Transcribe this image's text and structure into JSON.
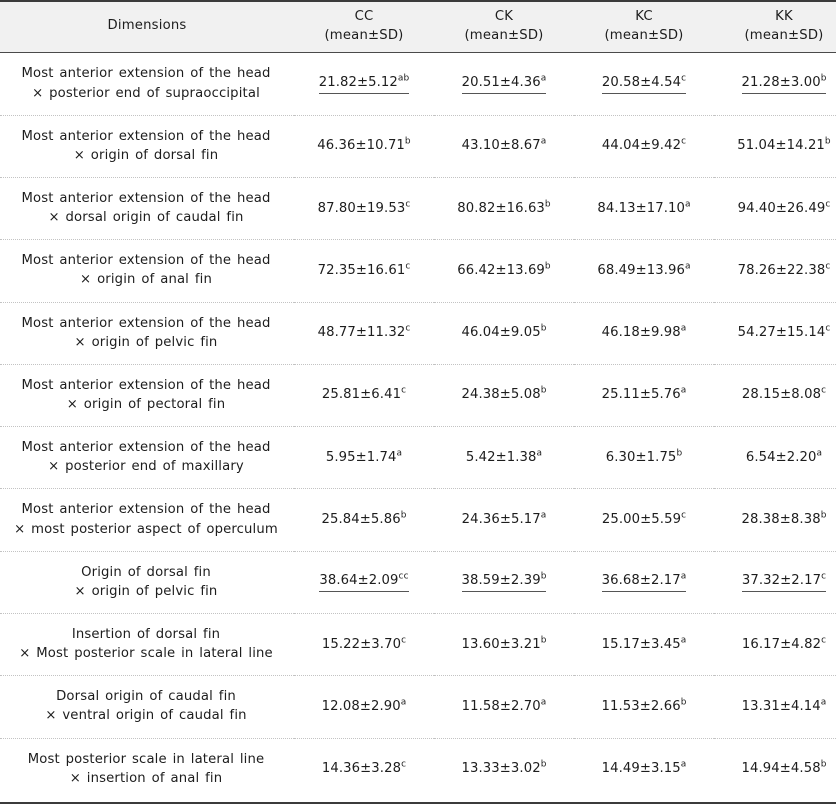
{
  "table": {
    "header": {
      "dimensions_label": "Dimensions",
      "sub_label": "(mean±SD)",
      "groups": [
        "CC",
        "CK",
        "KC",
        "KK"
      ]
    },
    "rows": [
      {
        "dimension_line1": "Most anterior extension of the head",
        "dimension_line2": "× posterior end of supraoccipital",
        "underlined": true,
        "values": [
          {
            "text": "21.82±5.12",
            "sup": "ab"
          },
          {
            "text": "20.51±4.36",
            "sup": "a"
          },
          {
            "text": "20.58±4.54",
            "sup": "c"
          },
          {
            "text": "21.28±3.00",
            "sup": "b"
          }
        ]
      },
      {
        "dimension_line1": "Most anterior extension of the head",
        "dimension_line2": "× origin of dorsal fin",
        "underlined": false,
        "values": [
          {
            "text": "46.36±10.71",
            "sup": "b"
          },
          {
            "text": "43.10±8.67",
            "sup": "a"
          },
          {
            "text": "44.04±9.42",
            "sup": "c"
          },
          {
            "text": "51.04±14.21",
            "sup": "b"
          }
        ]
      },
      {
        "dimension_line1": "Most anterior extension of the head",
        "dimension_line2": "× dorsal origin of caudal fin",
        "underlined": false,
        "wrap_col": 1,
        "values": [
          {
            "text": "87.80±19.53",
            "sup": "c"
          },
          {
            "text": "80.82±16.63",
            "sup": "b"
          },
          {
            "text": "84.13±17.10",
            "sup": "a"
          },
          {
            "text": "94.40±26.49",
            "sup": "c"
          }
        ]
      },
      {
        "dimension_line1": "Most anterior extension of the head",
        "dimension_line2": "× origin of anal fin",
        "underlined": false,
        "wrap_col": 1,
        "values": [
          {
            "text": "72.35±16.61",
            "sup": "c"
          },
          {
            "text": "66.42±13.69",
            "sup": "b"
          },
          {
            "text": "68.49±13.96",
            "sup": "a"
          },
          {
            "text": "78.26±22.38",
            "sup": "c"
          }
        ]
      },
      {
        "dimension_line1": "Most anterior extension of the head",
        "dimension_line2": "× origin of pelvic fin",
        "underlined": false,
        "values": [
          {
            "text": "48.77±11.32",
            "sup": "c"
          },
          {
            "text": "46.04±9.05",
            "sup": "b"
          },
          {
            "text": "46.18±9.98",
            "sup": "a"
          },
          {
            "text": "54.27±15.14",
            "sup": "c"
          }
        ]
      },
      {
        "dimension_line1": "Most anterior extension of the head",
        "dimension_line2": "× origin of pectoral fin",
        "underlined": false,
        "values": [
          {
            "text": "25.81±6.41",
            "sup": "c"
          },
          {
            "text": "24.38±5.08",
            "sup": "b"
          },
          {
            "text": "25.11±5.76",
            "sup": "a"
          },
          {
            "text": "28.15±8.08",
            "sup": "c"
          }
        ]
      },
      {
        "dimension_line1": "Most anterior extension of the head",
        "dimension_line2": "× posterior end of maxillary",
        "underlined": false,
        "values": [
          {
            "text": "5.95±1.74",
            "sup": "a"
          },
          {
            "text": "5.42±1.38",
            "sup": "a"
          },
          {
            "text": "6.30±1.75",
            "sup": "b"
          },
          {
            "text": "6.54±2.20",
            "sup": "a"
          }
        ]
      },
      {
        "dimension_line1": "Most anterior extension of the head",
        "dimension_line2": "× most posterior aspect of operculum",
        "underlined": false,
        "values": [
          {
            "text": "25.84±5.86",
            "sup": "b"
          },
          {
            "text": "24.36±5.17",
            "sup": "a"
          },
          {
            "text": "25.00±5.59",
            "sup": "c"
          },
          {
            "text": "28.38±8.38",
            "sup": "b"
          }
        ]
      },
      {
        "dimension_line1": "Origin of dorsal fin",
        "dimension_line2": "× origin of pelvic fin",
        "underlined": true,
        "values": [
          {
            "text": "38.64±2.09",
            "sup": "cc"
          },
          {
            "text": "38.59±2.39",
            "sup": "b"
          },
          {
            "text": "36.68±2.17",
            "sup": "a"
          },
          {
            "text": "37.32±2.17",
            "sup": "c"
          }
        ]
      },
      {
        "dimension_line1": "Insertion of dorsal fin",
        "dimension_line2": "× Most posterior scale in lateral line",
        "underlined": false,
        "values": [
          {
            "text": "15.22±3.70",
            "sup": "c"
          },
          {
            "text": "13.60±3.21",
            "sup": "b"
          },
          {
            "text": "15.17±3.45",
            "sup": "a"
          },
          {
            "text": "16.17±4.82",
            "sup": "c"
          }
        ]
      },
      {
        "dimension_line1": "Dorsal origin of caudal fin",
        "dimension_line2": "× ventral origin of caudal fin",
        "underlined": false,
        "values": [
          {
            "text": "12.08±2.90",
            "sup": "a"
          },
          {
            "text": "11.58±2.70",
            "sup": "a"
          },
          {
            "text": "11.53±2.66",
            "sup": "b"
          },
          {
            "text": "13.31±4.14",
            "sup": "a"
          }
        ]
      },
      {
        "dimension_line1": "Most posterior scale in lateral line",
        "dimension_line2": "× insertion of anal fin",
        "underlined": false,
        "values": [
          {
            "text": "14.36±3.28",
            "sup": "c"
          },
          {
            "text": "13.33±3.02",
            "sup": "b"
          },
          {
            "text": "14.49±3.15",
            "sup": "a"
          },
          {
            "text": "14.94±4.58",
            "sup": "b"
          }
        ]
      }
    ]
  },
  "colors": {
    "rule": "#3b3b3b",
    "header_bg": "#f1f1f1",
    "row_divider": "#c3c3c3",
    "text": "#1d1d1d"
  }
}
